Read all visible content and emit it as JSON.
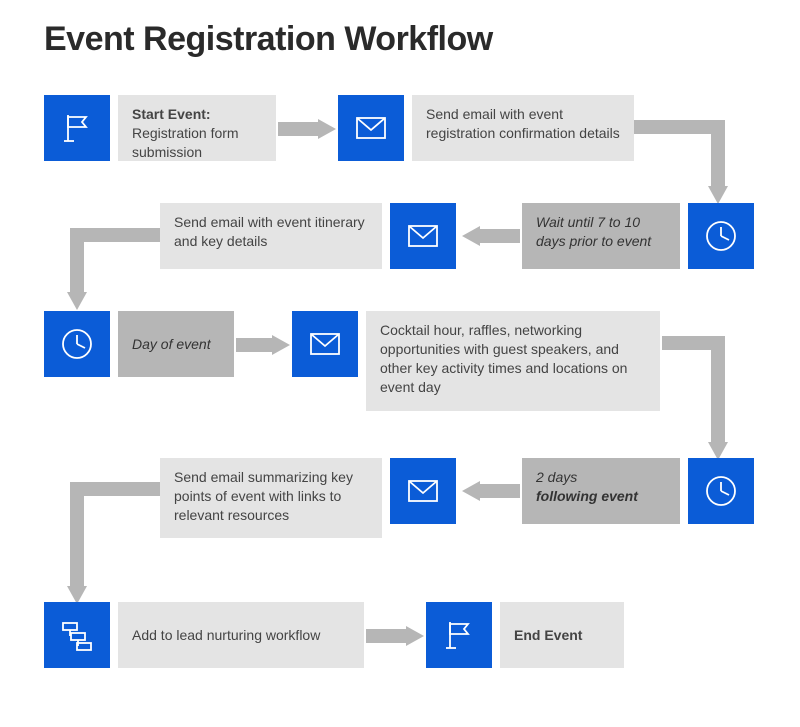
{
  "title": "Event Registration Workflow",
  "steps": {
    "start_label": "Start Event:",
    "start_desc": "Registration form submission",
    "step2": "Send email with event registration confirmation details",
    "wait1_a": "Wait until 7 to 10",
    "wait1_b": "days prior to event",
    "step3": "Send email with event itinerary and key details",
    "wait2": "Day of event",
    "step4": "Cocktail hour, raffles, networking opportunities with guest speakers, and other key activity times and locations on event day",
    "wait3_a": "2 days",
    "wait3_b": "following event",
    "step5": "Send email summarizing key points of event with links to relevant resources",
    "step6": "Add to lead nurturing workflow",
    "end_label": "End Event"
  }
}
